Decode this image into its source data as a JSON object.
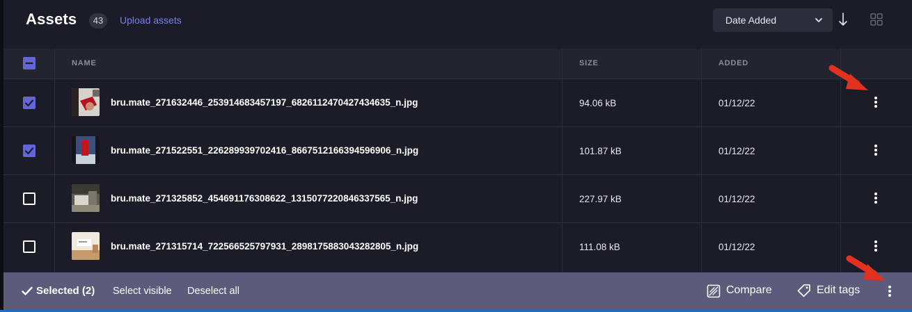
{
  "header": {
    "title": "Assets",
    "count": "43",
    "upload_label": "Upload assets",
    "sort": {
      "selected": "Date Added"
    }
  },
  "table": {
    "columns": {
      "name": "NAME",
      "size": "SIZE",
      "added": "ADDED"
    },
    "rows": [
      {
        "name": "bru.mate_271632446_253914683457197_6826112470427434635_n.jpg",
        "size": "94.06 kB",
        "added": "01/12/22",
        "checked": true
      },
      {
        "name": "bru.mate_271522551_226289939702416_8667512166394596906_n.jpg",
        "size": "101.87 kB",
        "added": "01/12/22",
        "checked": true
      },
      {
        "name": "bru.mate_271325852_454691176308622_1315077220846337565_n.jpg",
        "size": "227.97 kB",
        "added": "01/12/22",
        "checked": false
      },
      {
        "name": "bru.mate_271315714_722566525797931_2898175883043282805_n.jpg",
        "size": "111.08 kB",
        "added": "01/12/22",
        "checked": false
      }
    ]
  },
  "bottom_bar": {
    "selected_label": "Selected (2)",
    "select_visible": "Select visible",
    "deselect_all": "Deselect all",
    "compare": "Compare",
    "edit_tags": "Edit tags"
  },
  "colors": {
    "accent": "#6466d8",
    "link": "#7d7ff2",
    "annotation_arrow": "#e0321e",
    "bottom_bar": "#5b5b7b"
  }
}
